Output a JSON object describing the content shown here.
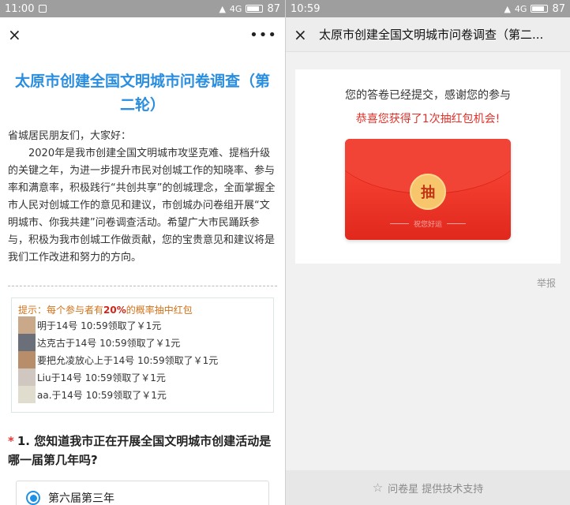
{
  "left": {
    "status": {
      "time": "11:00",
      "battery": "87",
      "net": "4G"
    },
    "nav": {
      "close": "×",
      "more": "•••"
    },
    "title": "太原市创建全国文明城市问卷调查（第二轮）",
    "greeting": "省城居民朋友们，大家好：",
    "intro": "2020年是我市创建全国文明城市攻坚克难、提档升级的关键之年，为进一步提升市民对创城工作的知晓率、参与率和满意率，积极践行“共创共享”的创城理念，全面掌握全市人民对创城工作的意见和建议，市创城办问卷组开展“文明城市、你我共建”问卷调查活动。希望广大市民踊跃参与，积极为我市创城工作做贡献，您的宝贵意见和建议将是我们工作改进和努力的方向。",
    "tip": {
      "prefix": "提示：每个参与者有",
      "rate": "20%",
      "suffix": "的概率抽中红包"
    },
    "winners": [
      {
        "text": "明于14号 10:59领取了￥1元",
        "color": "#c9a98a"
      },
      {
        "text": "达克古于14号 10:59领取了￥1元",
        "color": "#6b6f7a"
      },
      {
        "text": "要把允凌放心上于14号 10:59领取了￥1元",
        "color": "#b88e6a"
      },
      {
        "text": "Liu于14号 10:59领取了￥1元",
        "color": "#cfc7c0"
      },
      {
        "text": "aa.于14号 10:59领取了￥1元",
        "color": "#e0ddcf"
      }
    ],
    "question": {
      "required": "*",
      "text": "1. 您知道我市正在开展全国文明城市创建活动是哪一届第几年吗?"
    },
    "option1": "第六届第三年"
  },
  "right": {
    "status": {
      "time": "10:59",
      "battery": "87",
      "net": "4G"
    },
    "nav": {
      "close": "×",
      "title": "太原市创建全国文明城市问卷调查（第二..."
    },
    "submitted": "您的答卷已经提交，感谢您的参与",
    "congrats": "恭喜您获得了1次抽红包机会!",
    "draw_button": "抽",
    "luck_text": "祝您好运",
    "report": "举报",
    "footer": "问卷星 提供技术支持"
  },
  "colors": {
    "title_blue": "#2a8ee0",
    "tip_orange": "#d0721a",
    "congrats_red": "#e0312a",
    "envelope_red": "#f24436"
  }
}
